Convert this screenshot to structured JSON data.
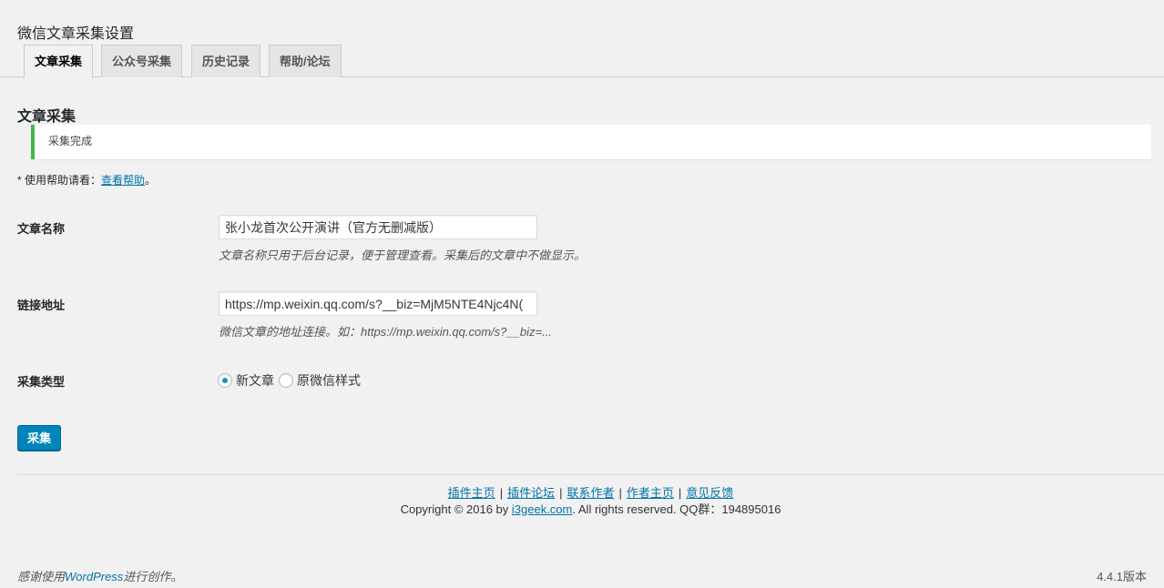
{
  "header": {
    "title": "微信文章采集设置"
  },
  "tabs": [
    {
      "label": "文章采集",
      "active": true
    },
    {
      "label": "公众号采集",
      "active": false
    },
    {
      "label": "历史记录",
      "active": false
    },
    {
      "label": "帮助/论坛",
      "active": false
    }
  ],
  "section": {
    "title": "文章采集"
  },
  "notice": {
    "text": "采集完成",
    "color": "#46b450"
  },
  "help": {
    "prefix": "* 使用帮助请看：",
    "link_text": "查看帮助",
    "suffix": "。"
  },
  "form": {
    "title_field": {
      "label": "文章名称",
      "value": "张小龙首次公开演讲（官方无删减版）",
      "description": "文章名称只用于后台记录，便于管理查看。采集后的文章中不做显示。"
    },
    "url_field": {
      "label": "链接地址",
      "value": "https://mp.weixin.qq.com/s?__biz=MjM5NTE4Njc4N(",
      "description": "微信文章的地址连接。如：https://mp.weixin.qq.com/s?__biz=..."
    },
    "type_field": {
      "label": "采集类型",
      "options": [
        {
          "label": "新文章",
          "checked": true
        },
        {
          "label": "原微信样式",
          "checked": false
        }
      ]
    },
    "submit_label": "采集"
  },
  "footer": {
    "links": [
      "插件主页",
      "插件论坛",
      "联系作者",
      "作者主页",
      "意见反馈"
    ],
    "separator": "|",
    "copyright_prefix": "Copyright © 2016 by ",
    "copyright_link": "i3geek.com",
    "copyright_suffix": ". All rights reserved. QQ群：194895016"
  },
  "wp_footer": {
    "thanks_prefix": "感谢使用",
    "thanks_link": "WordPress",
    "thanks_suffix": "进行创作。",
    "version": "4.4.1版本"
  },
  "colors": {
    "accent": "#0085ba",
    "link": "#0073aa",
    "success": "#46b450"
  }
}
